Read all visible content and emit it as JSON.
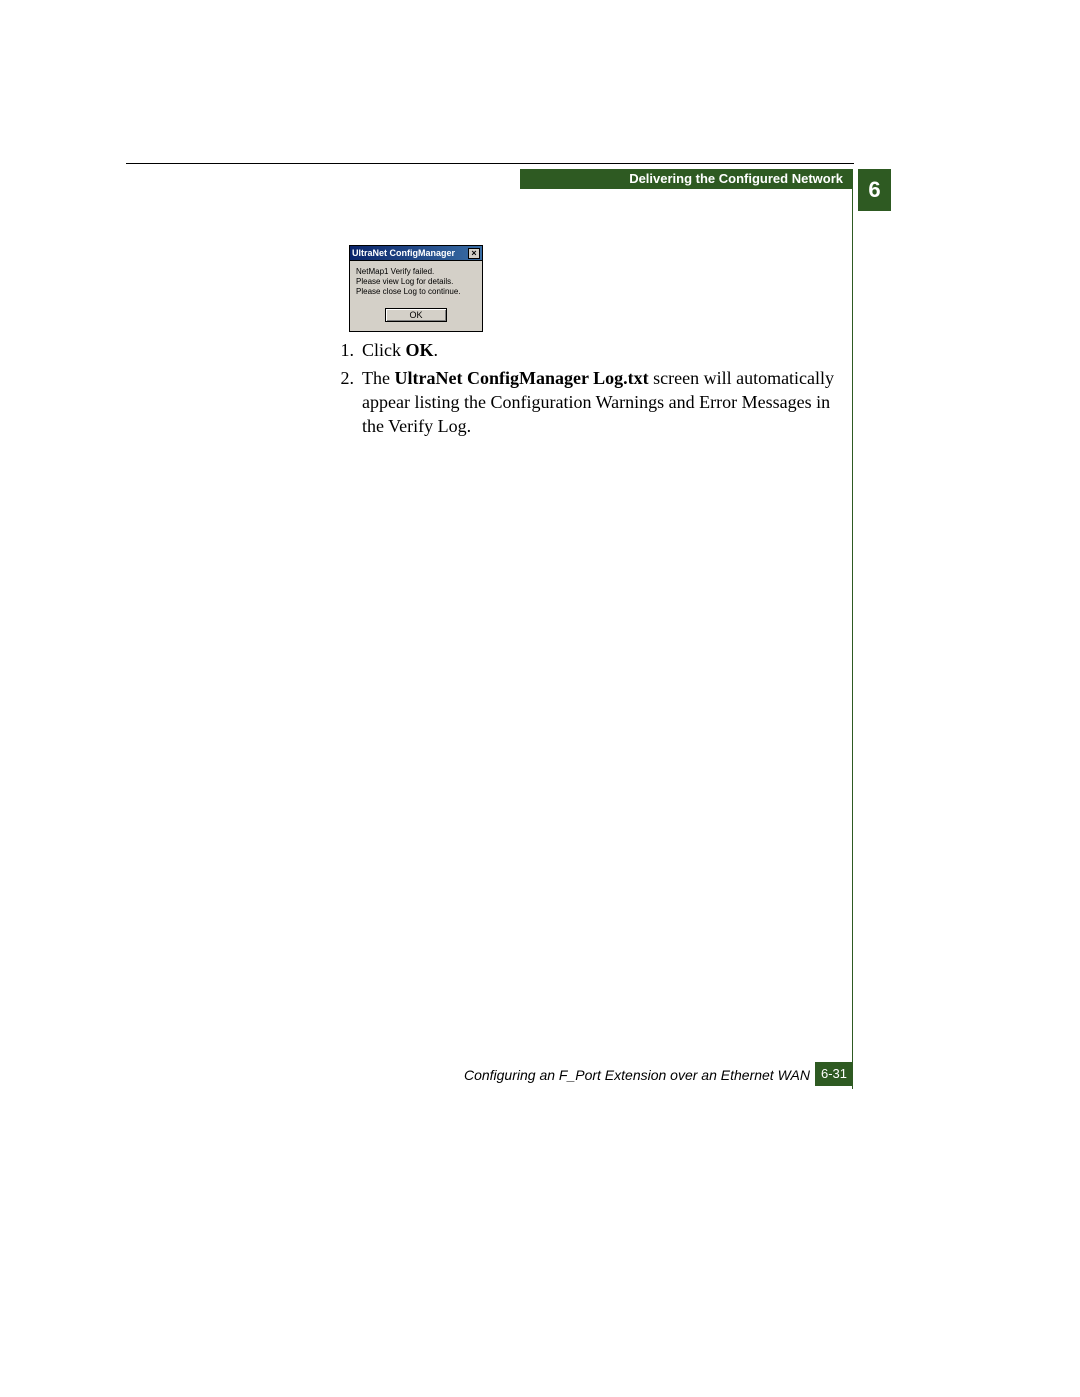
{
  "header": {
    "section_title": "Delivering the Configured Network",
    "chapter_number": "6"
  },
  "dialog": {
    "title": "UltraNet ConfigManager",
    "close_glyph": "×",
    "message_line1": "NetMap1 Verify failed.",
    "message_line2": "Please view Log for details.",
    "message_line3": "Please close Log to continue.",
    "ok_label": "OK"
  },
  "steps": {
    "item1_num": "1.",
    "item1_pre": "Click ",
    "item1_bold": "OK",
    "item1_post": ".",
    "item2_num": "2.",
    "item2_pre": "The ",
    "item2_bold": "UltraNet ConfigManager Log.txt",
    "item2_post": " screen will automatically appear listing the Configuration Warnings and Error Messages in the Verify Log."
  },
  "footer": {
    "doc_title": "Configuring an F_Port Extension over an Ethernet WAN",
    "page_number": "6-31"
  }
}
